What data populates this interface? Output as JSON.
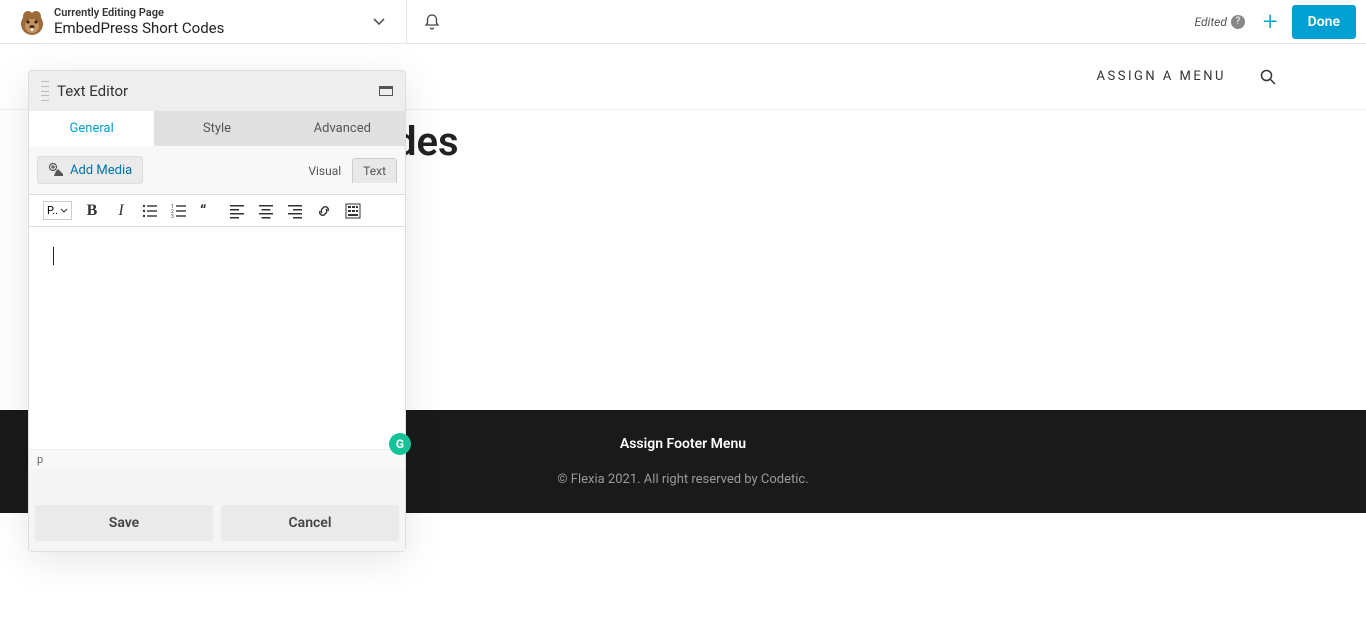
{
  "header": {
    "status": "Currently Editing Page",
    "page_title": "EmbedPress Short Codes",
    "edited_label": "Edited",
    "done_label": "Done"
  },
  "site": {
    "assign_menu": "ASSIGN A MENU",
    "heading_fragment": "des",
    "footer_menu": "Assign Footer Menu",
    "footer_copy": "© Flexia 2021. All right reserved by Codetic."
  },
  "panel": {
    "title": "Text Editor",
    "tabs": {
      "general": "General",
      "style": "Style",
      "advanced": "Advanced"
    },
    "add_media": "Add Media",
    "visual": "Visual",
    "text_tab": "Text",
    "format_select": "P..",
    "path": "p",
    "save": "Save",
    "cancel": "Cancel",
    "grammarly": "G"
  }
}
